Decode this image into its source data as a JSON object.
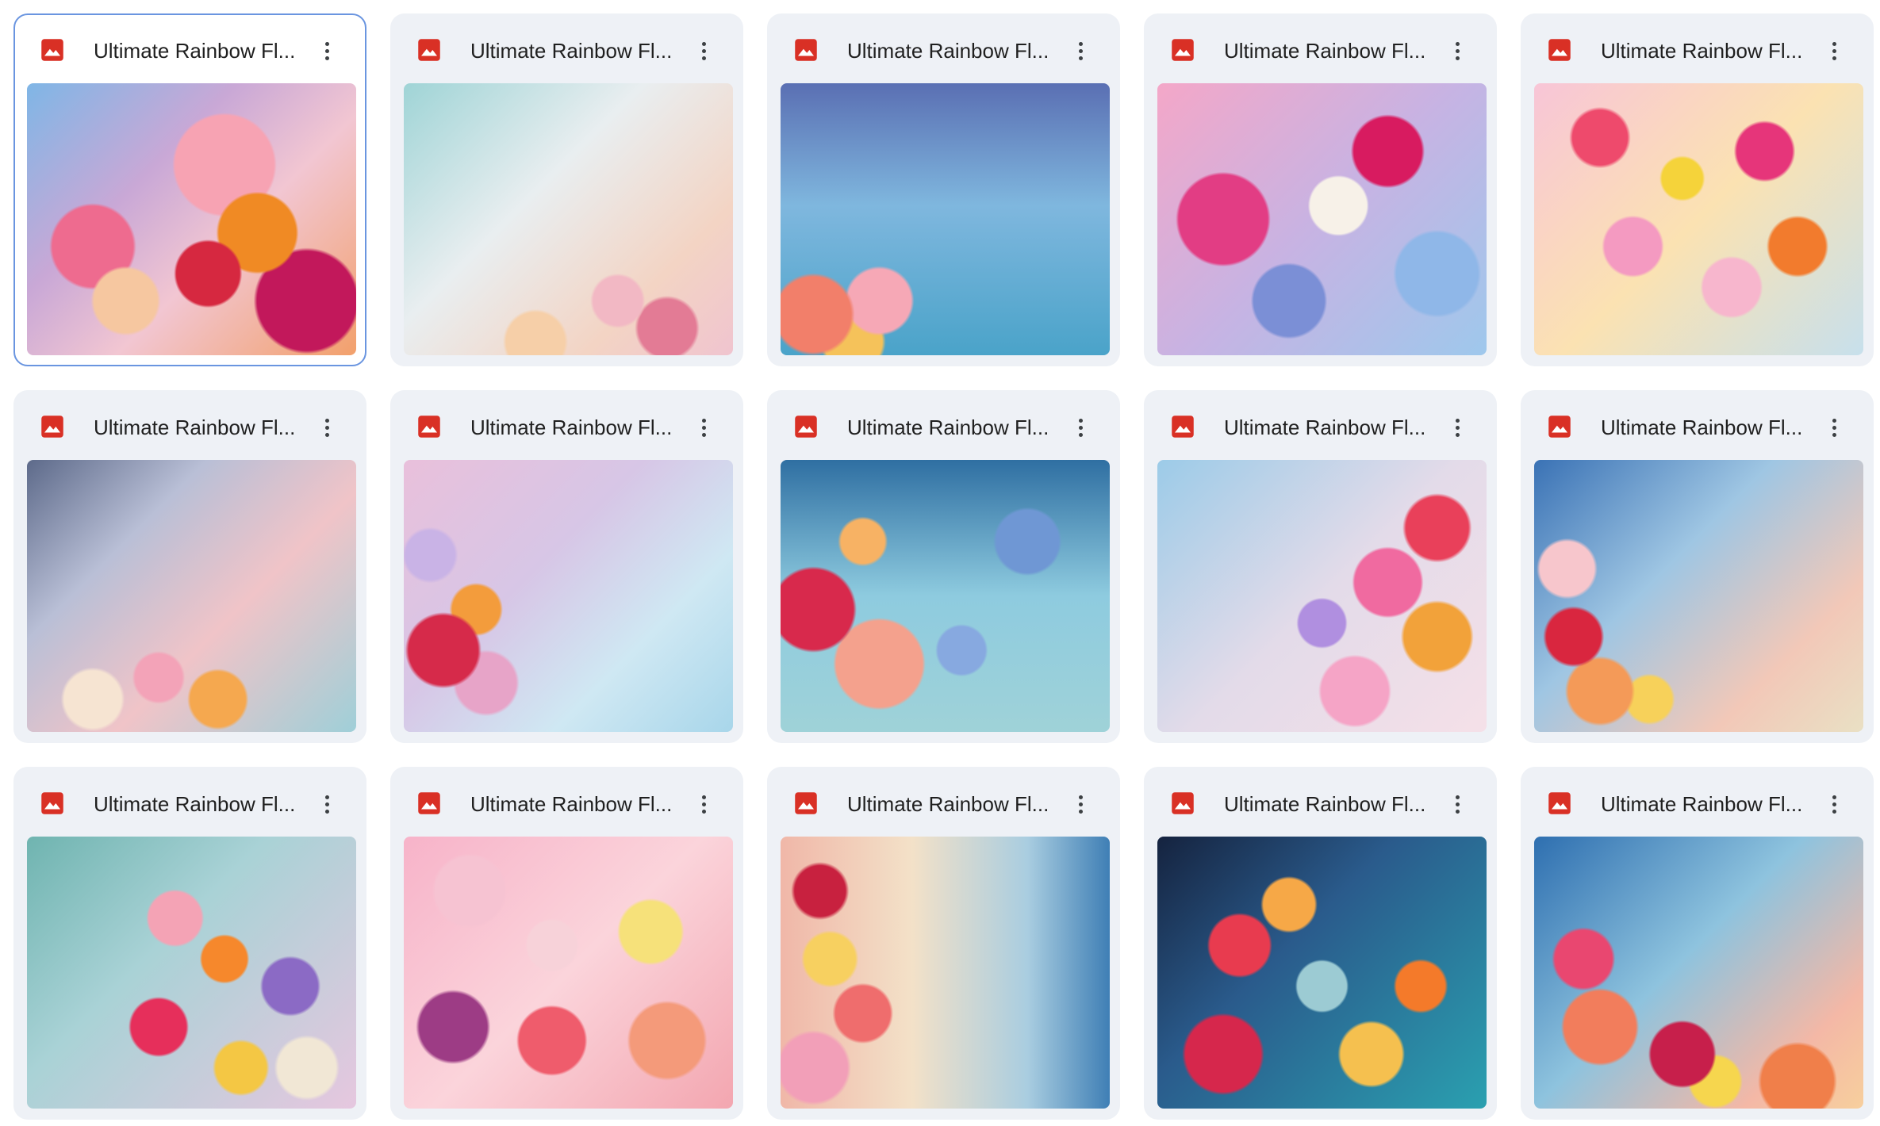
{
  "files": [
    {
      "title": "Ultimate Rainbow Fl...",
      "icon": "image-file-icon",
      "selected": true
    },
    {
      "title": "Ultimate Rainbow Fl...",
      "icon": "image-file-icon",
      "selected": false
    },
    {
      "title": "Ultimate Rainbow Fl...",
      "icon": "image-file-icon",
      "selected": false
    },
    {
      "title": "Ultimate Rainbow Fl...",
      "icon": "image-file-icon",
      "selected": false
    },
    {
      "title": "Ultimate Rainbow Fl...",
      "icon": "image-file-icon",
      "selected": false
    },
    {
      "title": "Ultimate Rainbow Fl...",
      "icon": "image-file-icon",
      "selected": false
    },
    {
      "title": "Ultimate Rainbow Fl...",
      "icon": "image-file-icon",
      "selected": false
    },
    {
      "title": "Ultimate Rainbow Fl...",
      "icon": "image-file-icon",
      "selected": false
    },
    {
      "title": "Ultimate Rainbow Fl...",
      "icon": "image-file-icon",
      "selected": false
    },
    {
      "title": "Ultimate Rainbow Fl...",
      "icon": "image-file-icon",
      "selected": false
    },
    {
      "title": "Ultimate Rainbow Fl...",
      "icon": "image-file-icon",
      "selected": false
    },
    {
      "title": "Ultimate Rainbow Fl...",
      "icon": "image-file-icon",
      "selected": false
    },
    {
      "title": "Ultimate Rainbow Fl...",
      "icon": "image-file-icon",
      "selected": false
    },
    {
      "title": "Ultimate Rainbow Fl...",
      "icon": "image-file-icon",
      "selected": false
    },
    {
      "title": "Ultimate Rainbow Fl...",
      "icon": "image-file-icon",
      "selected": false
    }
  ],
  "colors": {
    "card_background": "#eef1f6",
    "selected_border": "#6a95e0",
    "image_icon_red": "#d93025",
    "title_text": "#1f1f1f"
  }
}
